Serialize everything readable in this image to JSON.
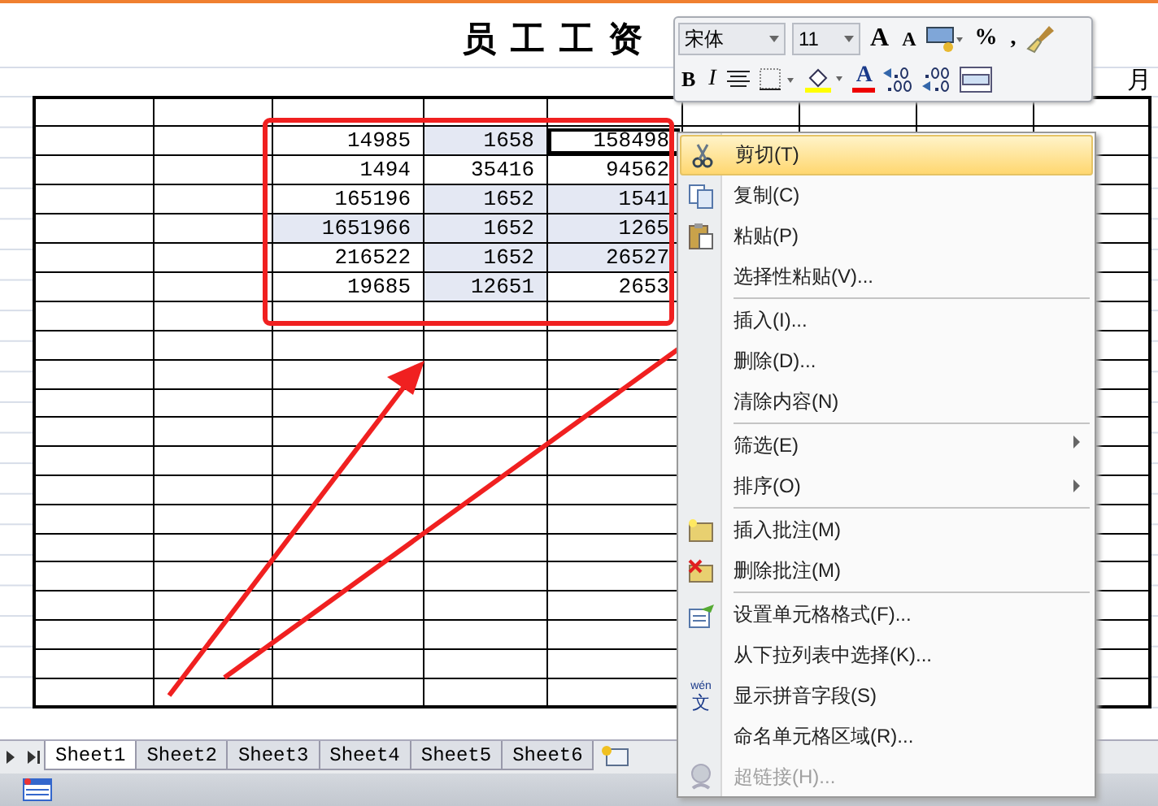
{
  "sheet": {
    "title": "员工工资",
    "month_label": "月",
    "data_rows": [
      [
        {
          "text": "14985",
          "selected": false,
          "active": false
        },
        {
          "text": "1658",
          "selected": true,
          "active": false
        },
        {
          "text": "158498",
          "selected": false,
          "active": true
        }
      ],
      [
        {
          "text": "1494",
          "selected": false,
          "active": false
        },
        {
          "text": "35416",
          "selected": false,
          "active": false
        },
        {
          "text": "94562",
          "selected": false,
          "active": false
        }
      ],
      [
        {
          "text": "165196",
          "selected": false,
          "active": false
        },
        {
          "text": "1652",
          "selected": true,
          "active": false
        },
        {
          "text": "1541",
          "selected": true,
          "active": false
        }
      ],
      [
        {
          "text": "1651966",
          "selected": true,
          "active": false
        },
        {
          "text": "1652",
          "selected": true,
          "active": false
        },
        {
          "text": "1265",
          "selected": true,
          "active": false
        }
      ],
      [
        {
          "text": "216522",
          "selected": false,
          "active": false
        },
        {
          "text": "1652",
          "selected": true,
          "active": false
        },
        {
          "text": "26527",
          "selected": true,
          "active": false
        }
      ],
      [
        {
          "text": "19685",
          "selected": false,
          "active": false
        },
        {
          "text": "12651",
          "selected": true,
          "active": false
        },
        {
          "text": "2653",
          "selected": false,
          "active": false
        }
      ]
    ]
  },
  "mini_toolbar": {
    "font_name": "宋体",
    "font_size": "11",
    "grow_font": "A",
    "shrink_font": "A",
    "percent": "%",
    "comma": ",",
    "bold": "B",
    "italic": "I",
    "font_color": "A"
  },
  "context_menu": [
    {
      "label": "剪切(T)",
      "kind": "cut",
      "highlighted": true,
      "disabled": false,
      "submenu": false,
      "separator_before": false
    },
    {
      "label": "复制(C)",
      "kind": "copy",
      "highlighted": false,
      "disabled": false,
      "submenu": false,
      "separator_before": false
    },
    {
      "label": "粘贴(P)",
      "kind": "paste",
      "highlighted": false,
      "disabled": false,
      "submenu": false,
      "separator_before": false
    },
    {
      "label": "选择性粘贴(V)...",
      "kind": "plain",
      "highlighted": false,
      "disabled": false,
      "submenu": false,
      "separator_before": false
    },
    {
      "label": "插入(I)...",
      "kind": "plain",
      "highlighted": false,
      "disabled": false,
      "submenu": false,
      "separator_before": true
    },
    {
      "label": "删除(D)...",
      "kind": "plain",
      "highlighted": false,
      "disabled": false,
      "submenu": false,
      "separator_before": false
    },
    {
      "label": "清除内容(N)",
      "kind": "plain",
      "highlighted": false,
      "disabled": false,
      "submenu": false,
      "separator_before": false
    },
    {
      "label": "筛选(E)",
      "kind": "plain",
      "highlighted": false,
      "disabled": false,
      "submenu": true,
      "separator_before": true
    },
    {
      "label": "排序(O)",
      "kind": "plain",
      "highlighted": false,
      "disabled": false,
      "submenu": true,
      "separator_before": false
    },
    {
      "label": "插入批注(M)",
      "kind": "note",
      "highlighted": false,
      "disabled": false,
      "submenu": false,
      "separator_before": true
    },
    {
      "label": "删除批注(M)",
      "kind": "unnote",
      "highlighted": false,
      "disabled": false,
      "submenu": false,
      "separator_before": false
    },
    {
      "label": "设置单元格格式(F)...",
      "kind": "format",
      "highlighted": false,
      "disabled": false,
      "submenu": false,
      "separator_before": true
    },
    {
      "label": "从下拉列表中选择(K)...",
      "kind": "plain",
      "highlighted": false,
      "disabled": false,
      "submenu": false,
      "separator_before": false
    },
    {
      "label": "显示拼音字段(S)",
      "kind": "pinyin",
      "icon_ruby": "wén",
      "icon_glyph": "文",
      "highlighted": false,
      "disabled": false,
      "submenu": false,
      "separator_before": false
    },
    {
      "label": "命名单元格区域(R)...",
      "kind": "plain",
      "highlighted": false,
      "disabled": false,
      "submenu": false,
      "separator_before": false
    },
    {
      "label": "超链接(H)...",
      "kind": "link",
      "highlighted": false,
      "disabled": true,
      "submenu": false,
      "separator_before": false
    }
  ],
  "sheet_tabs": [
    {
      "label": "Sheet1",
      "selected": true
    },
    {
      "label": "Sheet2",
      "selected": false
    },
    {
      "label": "Sheet3",
      "selected": false
    },
    {
      "label": "Sheet4",
      "selected": false
    },
    {
      "label": "Sheet5",
      "selected": false
    },
    {
      "label": "Sheet6",
      "selected": false
    }
  ]
}
